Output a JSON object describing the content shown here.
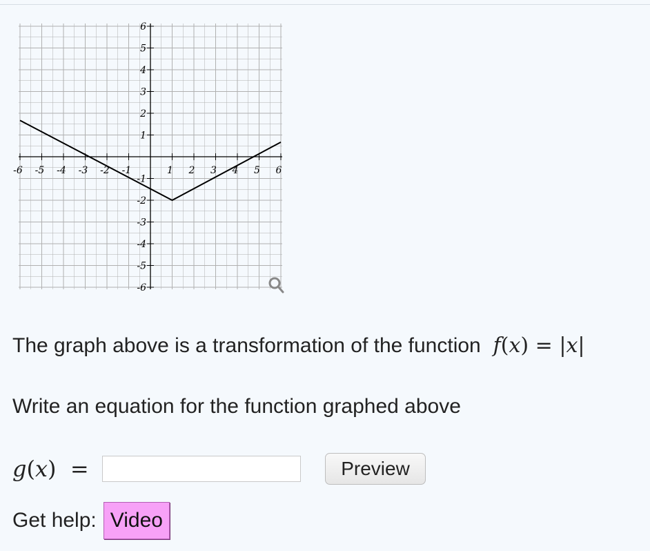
{
  "graph": {
    "x_tick_labels": [
      "-6",
      "-5",
      "-4",
      "-3",
      "-2",
      "-1",
      "1",
      "2",
      "3",
      "4",
      "5",
      "6"
    ],
    "y_tick_labels": [
      "-6",
      "-5",
      "-4",
      "-3",
      "-2",
      "-1",
      "1",
      "2",
      "3",
      "4",
      "5",
      "6"
    ],
    "xlim": [
      -6,
      6
    ],
    "ylim": [
      -6,
      6
    ],
    "grid": true,
    "line_points": [
      [
        -6,
        1.67
      ],
      [
        1,
        -2
      ],
      [
        6,
        0.67
      ]
    ],
    "line_color": "#000000",
    "grid_color": "#b0b0b0",
    "axis_color": "#000000",
    "zoom_icon": "magnifier-icon"
  },
  "question": {
    "text": "The graph above is a transformation of the function",
    "formula_f": "f",
    "formula_x": "x",
    "formula_eq": "=",
    "formula_abs_x": "x",
    "prompt": "Write an equation for the function graphed above"
  },
  "answer": {
    "label_g": "g",
    "label_x": "x",
    "label_eq": "=",
    "value": "",
    "placeholder": "",
    "preview_label": "Preview"
  },
  "help": {
    "label": "Get help:",
    "video_label": "Video",
    "video_color": "#f7a1f7"
  }
}
